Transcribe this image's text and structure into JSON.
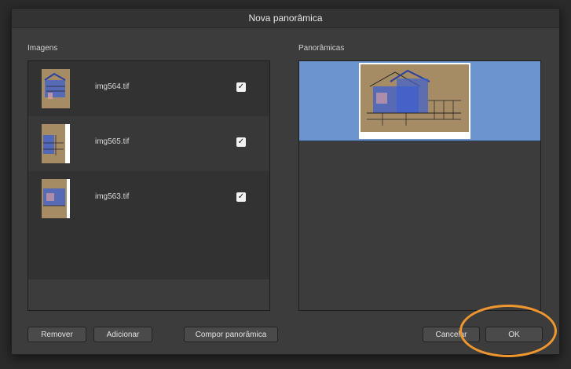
{
  "dialog": {
    "title": "Nova panorâmica"
  },
  "images": {
    "label": "Imagens",
    "items": [
      {
        "filename": "img564.tif",
        "checked": true,
        "check_glyph": "✓"
      },
      {
        "filename": "img565.tif",
        "checked": true,
        "check_glyph": "✓"
      },
      {
        "filename": "img563.tif",
        "checked": true,
        "check_glyph": "✓"
      }
    ]
  },
  "panoramas": {
    "label": "Panorâmicas",
    "selected_color": "#6c94cf"
  },
  "buttons": {
    "remove": "Remover",
    "add": "Adicionar",
    "compose": "Compor panorâmica",
    "cancel": "Cancelar",
    "ok": "OK"
  },
  "colors": {
    "highlight": "#f0962f",
    "sketch_blue": "#3d5fd0",
    "paper": "#a58c65"
  }
}
